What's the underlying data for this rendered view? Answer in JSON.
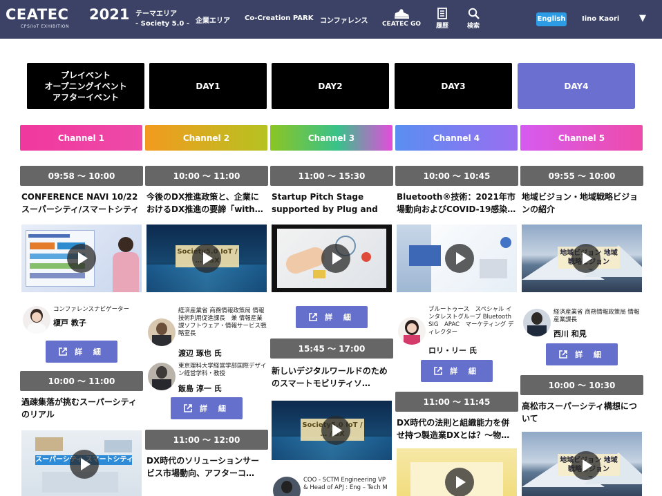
{
  "header": {
    "logo_text": "CEATEC",
    "logo_year": "2021",
    "logo_sub": "CPS/IoT EXHIBITION",
    "nav": {
      "theme_line1": "テーマエリア",
      "theme_line2": "- Society 5.0 -",
      "companies": "企業エリア",
      "park": "Co-Creation PARK",
      "conference": "コンファレンス",
      "go": "CEATEC GO",
      "history": "履歴",
      "search": "検索"
    },
    "lang_button": "English",
    "user_name": "Iino Kaori",
    "user_caret": "▼"
  },
  "day_tabs": [
    {
      "label": "プレイベント\nオープニングイベント\nアフターイベント"
    },
    {
      "label": "DAY1"
    },
    {
      "label": "DAY2"
    },
    {
      "label": "DAY3"
    },
    {
      "label": "DAY4",
      "active": true
    }
  ],
  "channel_tabs": [
    {
      "label": "Channel 1"
    },
    {
      "label": "Channel 2"
    },
    {
      "label": "Channel 3"
    },
    {
      "label": "Channel 4"
    },
    {
      "label": "Channel 5"
    }
  ],
  "detail_label": "詳 細",
  "columns": [
    {
      "sessions": [
        {
          "time": "09:58 ～ 10:00",
          "title": "CONFERENCE NAVI 10/22 スーパーシティ/スマートシティ",
          "speakers": [
            {
              "role": "コンファレンスナビゲーター",
              "name": "榎戸 教子"
            }
          ]
        },
        {
          "time": "10:00 ～ 11:00",
          "title": "過疎集落が挑むスーパーシティのリアル",
          "thumb_caption": "スーパーシティ スマートシティ"
        }
      ]
    },
    {
      "sessions": [
        {
          "time": "10:00 ～ 11:00",
          "title": "今後のDX推進政策と、企業におけるDX推進の要諦「with…",
          "thumb_caption": "Society5.0 IoT / … / SX",
          "speakers": [
            {
              "role": "経済産業省 商務情報政策局 情報技術利用促進課長　兼 情報産業課ソフトウェア・情報サービス戦略室長",
              "name": "渡辺 琢也 氏"
            },
            {
              "role": "東京理科大学経営学部国際デザイン経営学科・教授",
              "name": "飯島 淳一 氏"
            }
          ]
        },
        {
          "time": "11:00 ～ 12:00",
          "title": "DX時代のソリューションサービス市場動向、アフターコ…"
        }
      ]
    },
    {
      "sessions": [
        {
          "time": "11:00 ～ 15:30",
          "title": "Startup Pitch Stage supported by Plug and Pl…"
        },
        {
          "time": "15:45 ～ 17:00",
          "title": "新しいデジタルワールドのためのスマートモビリティソ…",
          "thumb_caption": "Society5.0 IoT / … / SX",
          "speakers": [
            {
              "role": "COO - SCTM Engineering VP & Head of APJ : Eng – Tech M",
              "name": ""
            }
          ]
        }
      ]
    },
    {
      "sessions": [
        {
          "time": "10:00 ～ 10:45",
          "title": "Bluetooth®技術：2021年市場動向およびCOVID-19感染…",
          "speakers": [
            {
              "role": "ブルートゥース　スペシャル インタレストグループ Bluetooth SIG　APAC　マーケティング ディレクター",
              "name": "ロリ・リー 氏"
            }
          ]
        },
        {
          "time": "11:00 ～ 11:45",
          "title": "DX時代の法則と組織能力を併せ持つ製造業DXとは？～物…"
        }
      ]
    },
    {
      "sessions": [
        {
          "time": "09:55 ～ 10:00",
          "title": "地域ビジョン・地域戦略ビジョンの紹介",
          "thumb_caption": "地域ビジョン 地域戦略ビジョン",
          "speakers": [
            {
              "role": "経済産業省 商務情報政策局 情報産業課長",
              "name": "西川 和見"
            }
          ]
        },
        {
          "time": "10:00 ～ 10:30",
          "title": "高松市スーパーシティ構想について",
          "thumb_caption": "地域ビジョン 地域戦略ビジョン"
        }
      ]
    }
  ],
  "colors": {
    "header_bg": "#3b4266",
    "active_day": "#6b6fcf",
    "time_bar": "#666666",
    "detail_button": "#6470cc",
    "lang_button": "#2e9be5"
  }
}
